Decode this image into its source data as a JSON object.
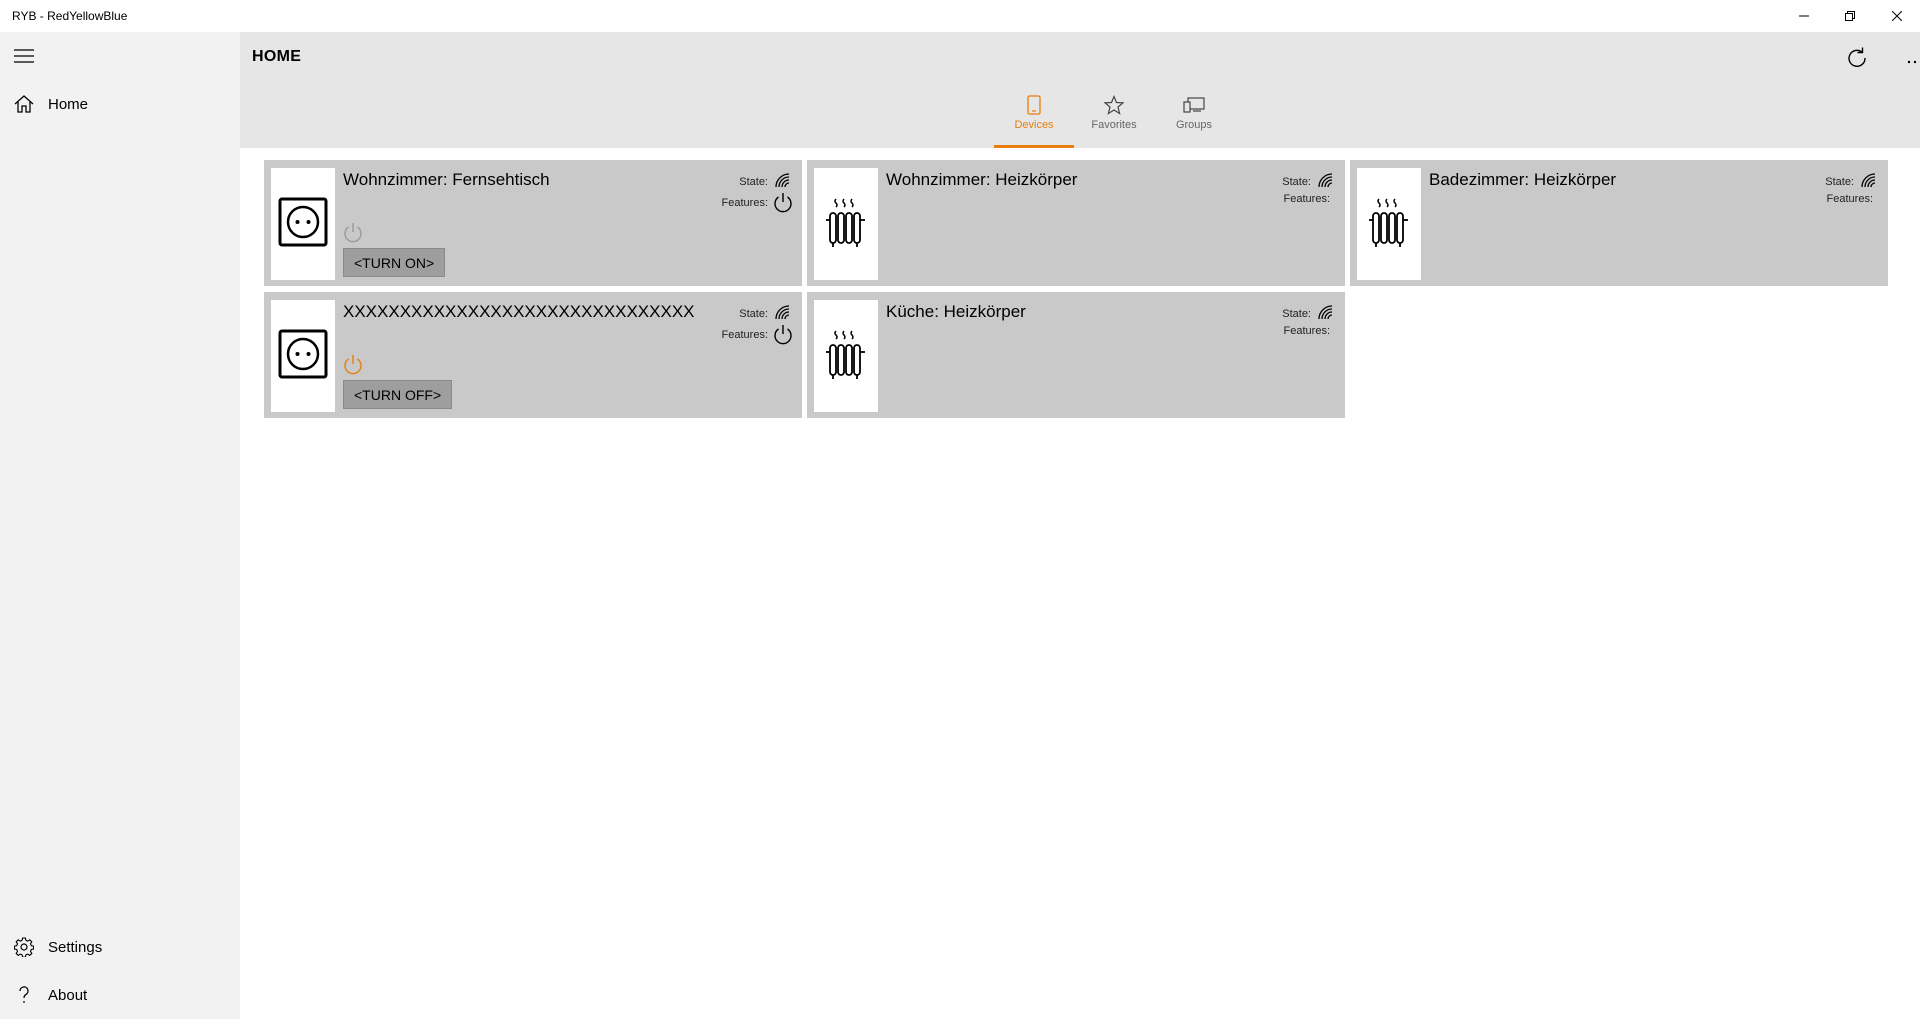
{
  "window": {
    "title": "RYB - RedYellowBlue",
    "minimize_icon": "minimize-icon",
    "restore_icon": "restore-icon",
    "close_icon": "close-icon"
  },
  "sidebar": {
    "menu_icon": "hamburger-icon",
    "items": [
      {
        "label": "Home",
        "icon": "home-icon"
      },
      {
        "label": "Settings",
        "icon": "gear-icon"
      },
      {
        "label": "About",
        "icon": "question-icon"
      }
    ]
  },
  "header": {
    "title": "HOME",
    "refresh_icon": "refresh-icon",
    "more_icon": "more-icon",
    "tabs": [
      {
        "label": "Devices",
        "icon": "phone-icon",
        "active": true
      },
      {
        "label": "Favorites",
        "icon": "star-icon",
        "active": false
      },
      {
        "label": "Groups",
        "icon": "devices-icon",
        "active": false
      }
    ]
  },
  "devices": [
    {
      "name": "Wohnzimmer: Fernsehtisch",
      "type": "socket",
      "state_label": "State:",
      "features_label": "Features:",
      "power_on": false,
      "action": "<TURN ON>"
    },
    {
      "name": "Wohnzimmer: Heizkörper",
      "type": "radiator",
      "state_label": "State:",
      "features_label": "Features:"
    },
    {
      "name": "Badezimmer: Heizkörper",
      "type": "radiator",
      "state_label": "State:",
      "features_label": "Features:"
    },
    {
      "name": "XXXXXXXXXXXXXXXXXXXXXXXXXXXXXXX",
      "type": "socket",
      "state_label": "State:",
      "features_label": "Features:",
      "power_on": true,
      "action": "<TURN OFF>"
    },
    {
      "name": "Küche: Heizkörper",
      "type": "radiator",
      "state_label": "State:",
      "features_label": "Features:"
    }
  ],
  "colors": {
    "accent": "#e87f0c",
    "sidebar_bg": "#f2f2f2",
    "header_bg": "#e6e6e6",
    "card_bg": "#c9c9c9",
    "button_bg": "#9e9e9e"
  }
}
